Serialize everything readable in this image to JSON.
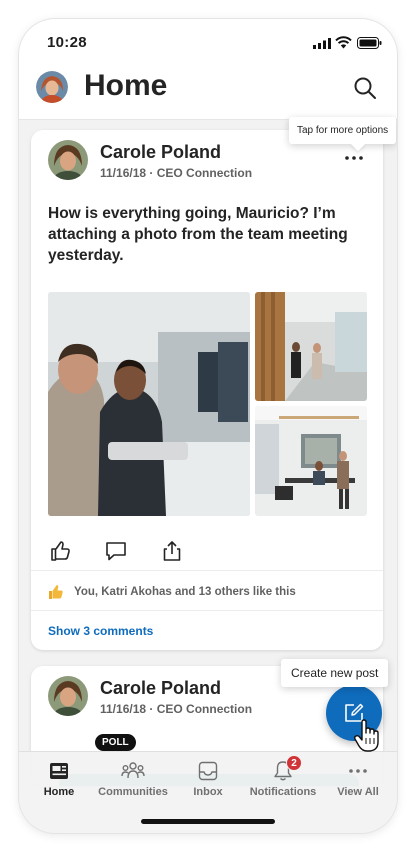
{
  "status_bar": {
    "time": "10:28"
  },
  "header": {
    "title": "Home"
  },
  "posts": [
    {
      "author": "Carole Poland",
      "meta": "11/16/18 · CEO Connection",
      "text": "How is everything going, Mauricio? I’m attaching a photo from the team meeting yesterday.",
      "likes_text": "You, Katri Akohas and 13 others like this",
      "comments_link": "Show 3 comments"
    },
    {
      "author": "Carole Poland",
      "meta": "11/16/18 · CEO Connection",
      "badge": "POLL"
    }
  ],
  "tooltips": {
    "more_options": "Tap for more options",
    "create_post": "Create new post"
  },
  "nav": {
    "items": [
      {
        "label": "Home",
        "icon": "home-icon"
      },
      {
        "label": "Communities",
        "icon": "communities-icon"
      },
      {
        "label": "Inbox",
        "icon": "inbox-icon"
      },
      {
        "label": "Notifications",
        "icon": "bell-icon",
        "badge": "2"
      },
      {
        "label": "View All",
        "icon": "more-icon"
      }
    ]
  },
  "colors": {
    "accent": "#0f6cbd",
    "badge": "#d13438",
    "poll": "#0e8a8c"
  }
}
